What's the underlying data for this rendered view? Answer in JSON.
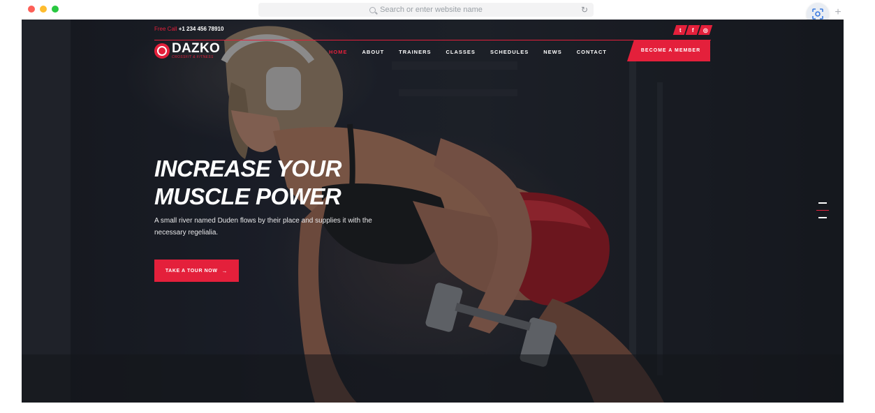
{
  "browser": {
    "address_placeholder": "Search or enter website name",
    "dots": [
      "#fd5f57",
      "#febc2e",
      "#28c840"
    ]
  },
  "site": {
    "phone_label": "Free Call",
    "phone_number": "+1 234 456 78910",
    "logo_name": "DAZKO",
    "logo_tagline": "CROSSFIT & FITNESS",
    "social": [
      "twitter-icon",
      "facebook-icon",
      "instagram-icon"
    ],
    "nav": [
      "HOME",
      "ABOUT",
      "TRAINERS",
      "CLASSES",
      "SCHEDULES",
      "NEWS",
      "CONTACT"
    ],
    "nav_active": "HOME",
    "member_button": "BECOME A MEMBER",
    "accent": "#e4203b"
  },
  "hero": {
    "headline_line1": "INCREASE YOUR",
    "headline_line2": "MUSCLE POWER",
    "subtitle": "A small river named Duden flows by their place and supplies it with the necessary regelialia.",
    "cta_label": "TAKE A TOUR NOW",
    "cta_arrow": "→",
    "slides": 3,
    "active_slide": 2
  }
}
